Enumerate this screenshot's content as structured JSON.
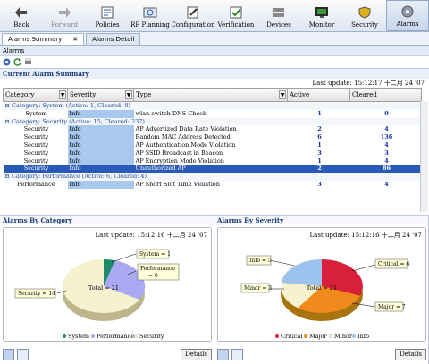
{
  "toolbar": {
    "buttons": [
      {
        "label": "Back",
        "icon": "back-arrow-icon"
      },
      {
        "label": "Forward",
        "icon": "forward-arrow-icon"
      },
      {
        "label": "Policies",
        "icon": "policies-icon"
      },
      {
        "label": "RF Planning",
        "icon": "rf-planning-icon"
      },
      {
        "label": "Configuration",
        "icon": "configuration-icon"
      },
      {
        "label": "Verification",
        "icon": "verification-icon"
      },
      {
        "label": "Devices",
        "icon": "devices-icon"
      },
      {
        "label": "Monitor",
        "icon": "monitor-icon"
      },
      {
        "label": "Security",
        "icon": "security-icon"
      },
      {
        "label": "Alarms",
        "icon": "alarms-icon"
      }
    ]
  },
  "tabs": {
    "summary": "Alarms Summary",
    "detail": "Alarms Detail",
    "close": "✖"
  },
  "breadcrumb": "Alarms",
  "summary": {
    "title": "Current Alarm Summary",
    "last_update": "Last update: 15:12:17 十二月 24 '07",
    "columns": {
      "category": "Category",
      "severity": "Severity",
      "type": "Type",
      "active": "Active",
      "cleared": "Cleared"
    },
    "groups": [
      {
        "header": "⊟ Category: System (Active: 1, Cleared: 0)",
        "rows": [
          {
            "category": "System",
            "severity": "Info",
            "type": "wlan-switch DNS Check",
            "active": "1",
            "cleared": "0"
          }
        ]
      },
      {
        "header": "⊟ Category: Security (Active: 15, Cleared: 237)",
        "rows": [
          {
            "category": "Security",
            "severity": "Info",
            "type": "AP Advertized Data Rate Violation",
            "active": "2",
            "cleared": "4"
          },
          {
            "category": "Security",
            "severity": "Info",
            "type": "Random MAC Address Detected",
            "active": "6",
            "cleared": "136"
          },
          {
            "category": "Security",
            "severity": "Info",
            "type": "AP Authentication Mode Violation",
            "active": "1",
            "cleared": "4"
          },
          {
            "category": "Security",
            "severity": "Info",
            "type": "AP SSID Broadcast in Beacon",
            "active": "3",
            "cleared": "3"
          },
          {
            "category": "Security",
            "severity": "Info",
            "type": "AP Encryption Mode Violation",
            "active": "1",
            "cleared": "4"
          },
          {
            "category": "Security",
            "severity": "Info",
            "type": "Unauthorized AP",
            "active": "2",
            "cleared": "86"
          }
        ]
      },
      {
        "header": "⊟ Category: Performance (Active: 6, Cleared: 4)",
        "rows": [
          {
            "category": "Performance",
            "severity": "Info",
            "type": "AP Short Slot Time Violation",
            "active": "3",
            "cleared": "4"
          }
        ]
      }
    ]
  },
  "by_category": {
    "title": "Alarms By Category",
    "last_update": "Last update: 15:12:16 十二月 24 '07",
    "total": "Total = 21",
    "labels": [
      "System = 1",
      "Performance = 6",
      "Security = 14"
    ],
    "legend": [
      "System",
      "Performance",
      "Security"
    ],
    "colors": [
      "#1f8a6a",
      "#a9a9f3",
      "#f6f1cf"
    ],
    "details": "Details"
  },
  "by_severity": {
    "title": "Alarms By Severity",
    "last_update": "Last update: 15:12:16 十二月 24 '07",
    "total": "Total = 21",
    "labels": [
      "Info = 5",
      "Critical = 6",
      "Minor = 3",
      "Major = 7"
    ],
    "legend": [
      "Critical",
      "Major",
      "Minor",
      "Info"
    ],
    "colors": [
      "#d9203a",
      "#f08a1c",
      "#f6f1cf",
      "#9cc3ee"
    ],
    "details": "Details"
  }
}
